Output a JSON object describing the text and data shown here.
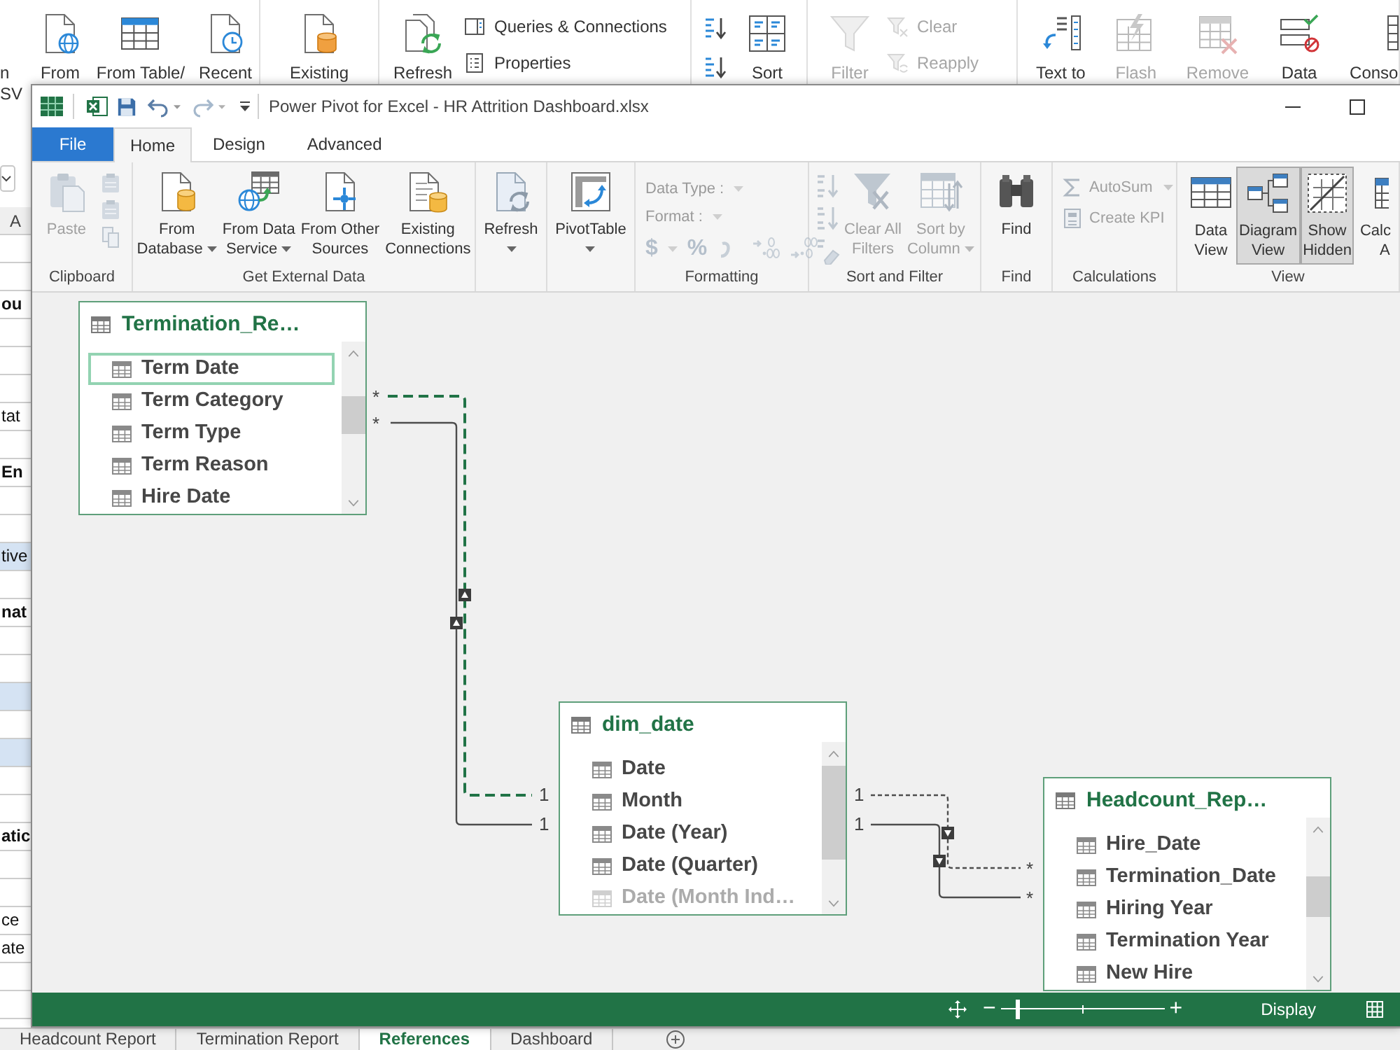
{
  "excel": {
    "ribbon_groups": [
      {
        "items": [
          {
            "kind": "large",
            "lines": [
              "From"
            ],
            "disabled": false
          },
          {
            "kind": "large",
            "lines": [
              "From Table/"
            ],
            "disabled": false
          },
          {
            "kind": "large",
            "lines": [
              "Recent"
            ],
            "disabled": false
          }
        ]
      },
      {
        "items": [
          {
            "kind": "large",
            "lines": [
              "Existing"
            ],
            "disabled": false
          }
        ]
      },
      {
        "items": [
          {
            "kind": "large",
            "lines": [
              "Refresh"
            ],
            "disabled": false
          },
          {
            "kind": "stack",
            "entries": [
              {
                "label": "Queries & Connections",
                "disabled": false
              },
              {
                "label": "Properties",
                "disabled": false
              }
            ]
          }
        ]
      },
      {
        "items": [
          {
            "kind": "stack",
            "entries": [
              {
                "disabled": false
              },
              {
                "disabled": false
              }
            ]
          },
          {
            "kind": "large",
            "lines": [
              "Sort"
            ],
            "disabled": false
          }
        ]
      },
      {
        "items": [
          {
            "kind": "large",
            "lines": [
              "Filter"
            ],
            "disabled": true
          },
          {
            "kind": "stack",
            "entries": [
              {
                "label": "Clear",
                "disabled": true
              },
              {
                "label": "Reapply",
                "disabled": true
              }
            ]
          }
        ]
      },
      {
        "items": [
          {
            "kind": "large",
            "lines": [
              "Text to"
            ],
            "disabled": false
          },
          {
            "kind": "large",
            "lines": [
              "Flash"
            ],
            "disabled": true
          },
          {
            "kind": "large",
            "lines": [
              "Remove"
            ],
            "disabled": true
          },
          {
            "kind": "large",
            "lines": [
              "Data"
            ],
            "disabled": false
          },
          {
            "kind": "large",
            "lines": [
              "Conso"
            ],
            "disabled": false
          }
        ]
      }
    ],
    "sheet_edge": {
      "button_lines": [
        "n",
        "SV"
      ],
      "column": "A",
      "rows": [
        {
          "shaded": false
        },
        {
          "shaded": false
        },
        {
          "text": "ou",
          "shaded": false,
          "bold": true
        },
        {
          "shaded": false
        },
        {
          "shaded": false
        },
        {
          "shaded": false
        },
        {
          "text": "tat",
          "shaded": false,
          "bold": false
        },
        {
          "shaded": false
        },
        {
          "text": "En",
          "shaded": false,
          "bold": true
        },
        {
          "shaded": false
        },
        {
          "shaded": false
        },
        {
          "text": "tive",
          "shaded": true,
          "bold": false
        },
        {
          "shaded": false
        },
        {
          "text": "nat",
          "shaded": false,
          "bold": true
        },
        {
          "shaded": false
        },
        {
          "shaded": false
        },
        {
          "shaded": true
        },
        {
          "shaded": false
        },
        {
          "shaded": true
        },
        {
          "shaded": false
        },
        {
          "shaded": false
        },
        {
          "text": "atic",
          "shaded": false,
          "bold": true
        },
        {
          "shaded": false
        },
        {
          "shaded": false
        },
        {
          "text": "ce",
          "shaded": false,
          "bold": false
        },
        {
          "text": "ate",
          "shaded": false,
          "bold": false
        },
        {
          "shaded": false
        },
        {
          "shaded": false
        }
      ]
    },
    "sheet_tabs": [
      {
        "label": "Headcount Report",
        "selected": false
      },
      {
        "label": "Termination Report",
        "selected": false
      },
      {
        "label": "References",
        "selected": true
      },
      {
        "label": "Dashboard",
        "selected": false
      }
    ]
  },
  "power_pivot": {
    "title": "Power Pivot for Excel - HR Attrition Dashboard.xlsx",
    "tabs": [
      {
        "label": "File",
        "kind": "file",
        "selected": false
      },
      {
        "label": "Home",
        "kind": "tab",
        "selected": true
      },
      {
        "label": "Design",
        "kind": "tab",
        "selected": false
      },
      {
        "label": "Advanced",
        "kind": "tab",
        "selected": false
      }
    ],
    "ribbon": {
      "groups": [
        {
          "label": "Clipboard",
          "items": [
            {
              "kind": "large",
              "lines": [
                "Paste"
              ],
              "dropdown": false,
              "disabled": true
            },
            {
              "kind": "stack",
              "entries": [
                {
                  "disabled": true
                },
                {
                  "disabled": true
                },
                {
                  "disabled": true
                }
              ]
            }
          ]
        },
        {
          "label": "Get External Data",
          "items": [
            {
              "kind": "large",
              "lines": [
                "From",
                "Database"
              ],
              "dropdown": true,
              "disabled": false
            },
            {
              "kind": "large",
              "lines": [
                "From Data",
                "Service"
              ],
              "dropdown": true,
              "disabled": false
            },
            {
              "kind": "large",
              "lines": [
                "From Other",
                "Sources"
              ],
              "dropdown": false,
              "disabled": false
            },
            {
              "kind": "large",
              "lines": [
                "Existing",
                "Connections"
              ],
              "dropdown": false,
              "disabled": false
            }
          ]
        },
        {
          "items": [
            {
              "kind": "large",
              "lines": [
                "Refresh"
              ],
              "dropdown": true,
              "disabled": false
            }
          ]
        },
        {
          "items": [
            {
              "kind": "large",
              "lines": [
                "PivotTable"
              ],
              "dropdown": true,
              "disabled": false
            }
          ]
        },
        {
          "label": "Formatting",
          "items": [
            {
              "kind": "format",
              "entries": [
                {
                  "label": "Data Type :",
                  "disabled": true
                },
                {
                  "label": "Format :",
                  "disabled": true
                }
              ],
              "symbols": [
                "$",
                "%"
              ],
              "disabled": true
            }
          ]
        },
        {
          "label": "Sort and Filter",
          "items": [
            {
              "kind": "stack",
              "entries": [
                {
                  "disabled": true
                },
                {
                  "disabled": true
                },
                {
                  "disabled": true
                }
              ]
            },
            {
              "kind": "large",
              "lines": [
                "Clear All",
                "Filters"
              ],
              "dropdown": false,
              "disabled": true
            },
            {
              "kind": "large",
              "lines": [
                "Sort by",
                "Column"
              ],
              "dropdown": true,
              "disabled": true
            }
          ]
        },
        {
          "label": "Find",
          "items": [
            {
              "kind": "large",
              "lines": [
                "Find"
              ],
              "dropdown": false,
              "disabled": false
            }
          ]
        },
        {
          "label": "Calculations",
          "items": [
            {
              "kind": "stack",
              "entries": [
                {
                  "label": "AutoSum",
                  "dropdown": true,
                  "disabled": true
                },
                {
                  "label": "Create KPI",
                  "dropdown": false,
                  "disabled": true
                }
              ]
            }
          ]
        },
        {
          "label": "View",
          "items": [
            {
              "kind": "toggle",
              "lines": [
                "Data",
                "View"
              ],
              "selected": false
            },
            {
              "kind": "toggle",
              "lines": [
                "Diagram",
                "View"
              ],
              "selected": true
            },
            {
              "kind": "toggle",
              "lines": [
                "Show",
                "Hidden"
              ],
              "selected": true
            },
            {
              "kind": "partial",
              "lines": [
                "Calc",
                "A"
              ],
              "selected": false
            }
          ]
        }
      ]
    },
    "diagram": {
      "tables": [
        {
          "title": "Termination_Re…",
          "rows": [
            {
              "name": "Term Date",
              "selected": true,
              "hidden": false
            },
            {
              "name": "Term Category",
              "selected": false,
              "hidden": false
            },
            {
              "name": "Term Type",
              "selected": false,
              "hidden": false
            },
            {
              "name": "Term Reason",
              "selected": false,
              "hidden": false
            },
            {
              "name": "Hire Date",
              "selected": false,
              "hidden": false
            }
          ]
        },
        {
          "title": "dim_date",
          "rows": [
            {
              "name": "Date",
              "selected": false,
              "hidden": false
            },
            {
              "name": "Month",
              "selected": false,
              "hidden": false
            },
            {
              "name": "Date (Year)",
              "selected": false,
              "hidden": false
            },
            {
              "name": "Date (Quarter)",
              "selected": false,
              "hidden": false
            },
            {
              "name": "Date (Month Ind…",
              "selected": false,
              "hidden": true
            }
          ]
        },
        {
          "title": "Headcount_Rep…",
          "rows": [
            {
              "name": "Hire_Date",
              "selected": false,
              "hidden": false
            },
            {
              "name": "Termination_Date",
              "selected": false,
              "hidden": false
            },
            {
              "name": "Hiring Year",
              "selected": false,
              "hidden": false
            },
            {
              "name": "Termination Year",
              "selected": false,
              "hidden": false
            },
            {
              "name": "New Hire",
              "selected": false,
              "hidden": false
            }
          ]
        }
      ],
      "relationships": [
        {
          "from_end": "*",
          "to_end": "1",
          "active": false,
          "highlighted": true
        },
        {
          "from_end": "*",
          "to_end": "1",
          "active": true,
          "highlighted": false
        },
        {
          "from_end": "1",
          "to_end": "*",
          "active": false,
          "highlighted": false
        },
        {
          "from_end": "1",
          "to_end": "*",
          "active": true,
          "highlighted": false
        }
      ]
    },
    "status_bar": {
      "zoom_out": "−",
      "zoom": {
        "level": 0.1
      },
      "zoom_in": "+",
      "display": "Display"
    }
  }
}
